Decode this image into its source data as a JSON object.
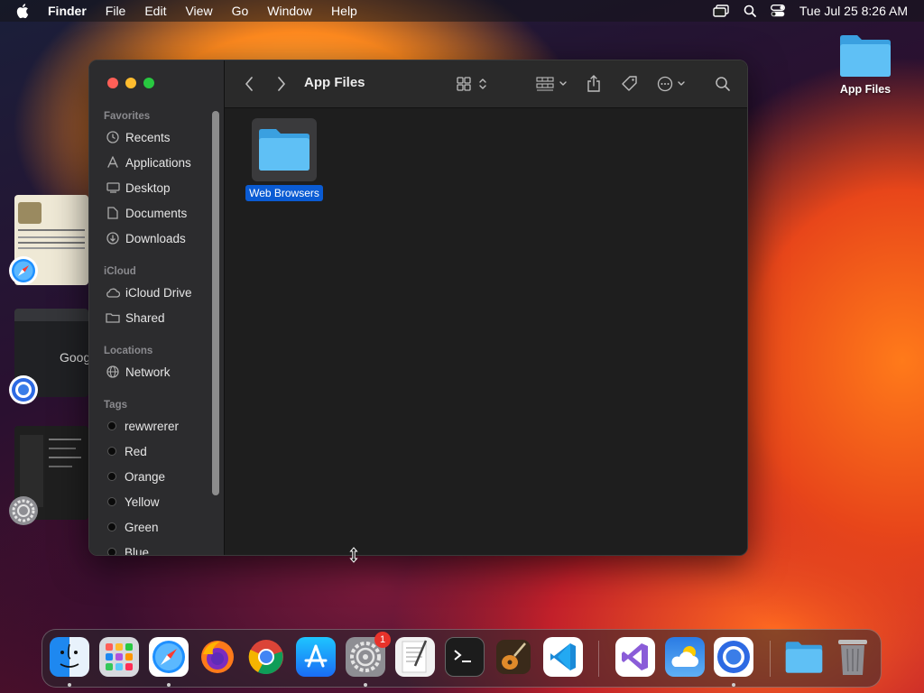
{
  "menubar": {
    "app": "Finder",
    "items": [
      "File",
      "Edit",
      "View",
      "Go",
      "Window",
      "Help"
    ],
    "clock": "Tue Jul 25  8:26 AM"
  },
  "desktop": {
    "folder_label": "App Files"
  },
  "window": {
    "title": "App Files",
    "sidebar": {
      "favorites_header": "Favorites",
      "favorites": [
        "Recents",
        "Applications",
        "Desktop",
        "Documents",
        "Downloads"
      ],
      "icloud_header": "iCloud",
      "icloud": [
        "iCloud Drive",
        "Shared"
      ],
      "locations_header": "Locations",
      "locations": [
        "Network"
      ],
      "tags_header": "Tags",
      "tags": [
        "rewwrerer",
        "Red",
        "Orange",
        "Yellow",
        "Green",
        "Blue"
      ]
    },
    "items": [
      {
        "name": "Web Browsers",
        "selected": true
      }
    ]
  },
  "dock": {
    "apps": [
      "Finder",
      "Launchpad",
      "Safari",
      "Firefox",
      "Chrome",
      "App Store",
      "System Settings",
      "TextEdit",
      "Terminal",
      "GarageBand",
      "Visual Studio Code",
      "Visual Studio",
      "Weather",
      "Chromium",
      "Downloads",
      "Trash"
    ],
    "settings_badge": "1"
  },
  "colors": {
    "accent": "#0a5bd3",
    "folder": "#4fb3ee",
    "red": "#ff5f57",
    "yellow": "#febc2e",
    "green": "#28c840"
  }
}
